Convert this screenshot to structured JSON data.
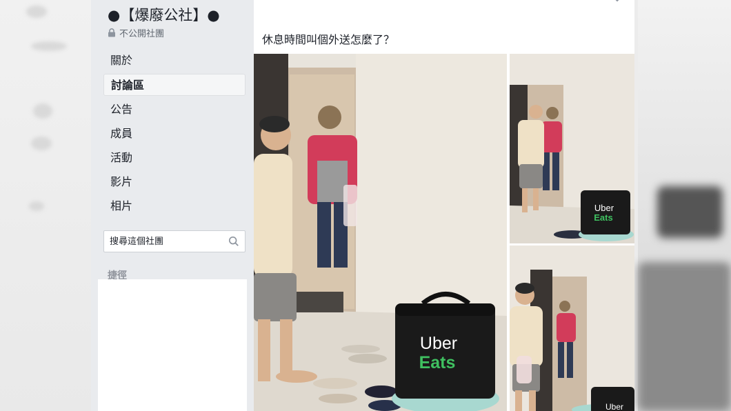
{
  "group": {
    "title": "●【爆廢公社】●",
    "privacy": "不公開社團"
  },
  "nav": {
    "items": [
      {
        "label": "關於"
      },
      {
        "label": "討論區"
      },
      {
        "label": "公告"
      },
      {
        "label": "成員"
      },
      {
        "label": "活動"
      },
      {
        "label": "影片"
      },
      {
        "label": "相片"
      }
    ],
    "active_index": 1
  },
  "search": {
    "placeholder": "搜尋這個社團"
  },
  "shortcuts": {
    "label": "捷徑"
  },
  "post": {
    "text": "休息時間叫個外送怎麼了？",
    "photos": [
      {
        "name": "main-photo",
        "bag_text_line1": "Uber",
        "bag_text_line2": "Eats"
      },
      {
        "name": "top-right-photo",
        "bag_text_line1": "Uber",
        "bag_text_line2": "Eats"
      },
      {
        "name": "bottom-right-photo",
        "bag_text_line1": "Uber"
      }
    ]
  },
  "colors": {
    "sidebar_bg": "#e9ebee",
    "uber_green": "#3fc060",
    "bag_black": "#1a1a1a"
  }
}
